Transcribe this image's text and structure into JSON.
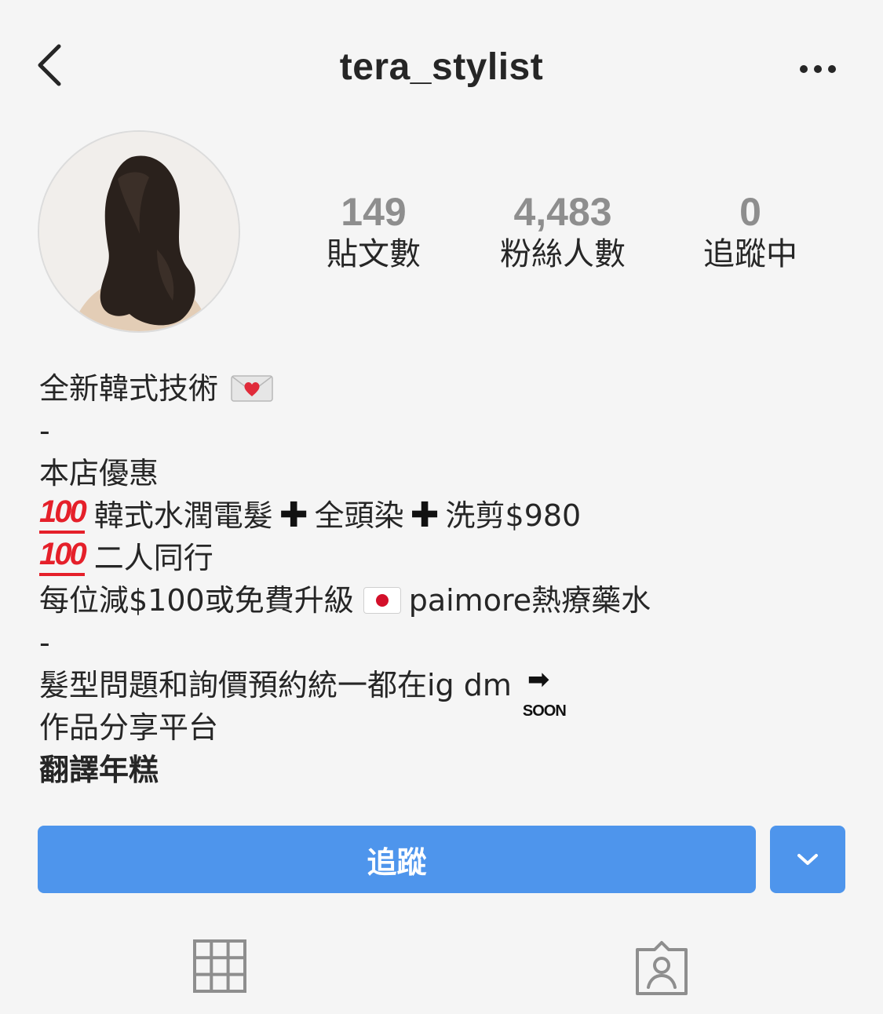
{
  "header": {
    "username": "tera_stylist",
    "back_icon": "chevron-left-icon",
    "more_icon": "ellipsis-icon"
  },
  "stats": {
    "posts": {
      "value": "149",
      "label": "貼文數"
    },
    "followers": {
      "value": "4,483",
      "label": "粉絲人數"
    },
    "following": {
      "value": "0",
      "label": "追蹤中"
    }
  },
  "bio": {
    "line1": "全新韓式技術",
    "line2": "-",
    "line3": "本店優惠",
    "line4_a": "韓式水潤電髮",
    "line4_b": "全頭染",
    "line4_c": "洗剪$980",
    "line5": "二人同行",
    "line6_a": "每位減$100或免費升級",
    "line6_b": "paimore熱療藥水",
    "line7": "-",
    "line8": "髮型問題和詢價預約統一都在ig dm",
    "line9": "作品分享平台",
    "line10": "翻譯年糕",
    "hundred": "100",
    "plus": "✚",
    "soon_arrow": "➡",
    "soon_text": "SOON"
  },
  "actions": {
    "follow_label": "追蹤",
    "dropdown_icon": "chevron-down-icon"
  },
  "tabs": {
    "grid_icon": "grid-icon",
    "tagged_icon": "tagged-person-icon"
  },
  "colors": {
    "accent": "#4e95ec",
    "background": "#f5f5f5",
    "text": "#262626",
    "stat_number": "#8e8e8e"
  }
}
